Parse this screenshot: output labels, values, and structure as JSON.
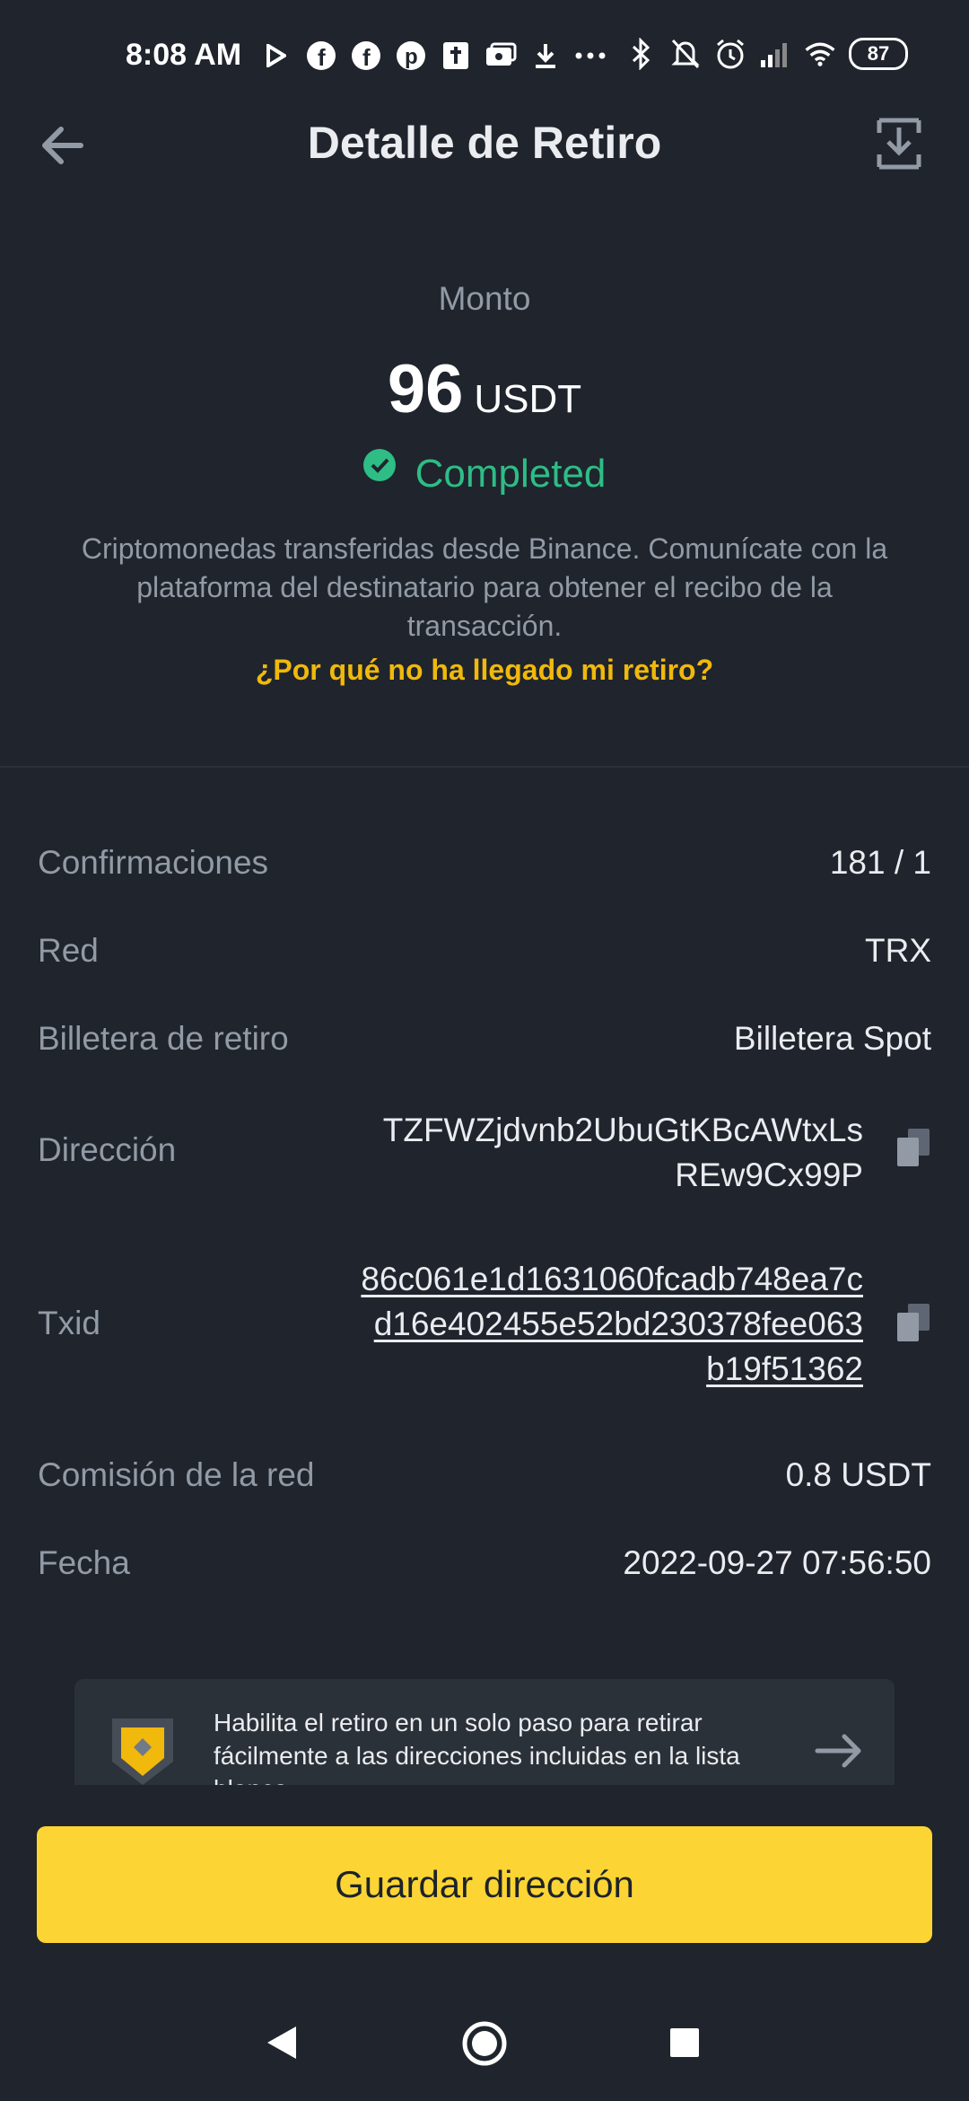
{
  "status_bar": {
    "time": "8:08 AM",
    "icons": [
      "play-icon",
      "facebook-icon",
      "facebook-icon",
      "pinterest-icon",
      "bible-icon",
      "money-icon",
      "download-icon",
      "more-icon",
      "bluetooth-icon",
      "mute-icon",
      "alarm-icon",
      "signal-icon",
      "wifi-icon"
    ],
    "battery": "87"
  },
  "header": {
    "title": "Detalle de Retiro"
  },
  "summary": {
    "amount_label": "Monto",
    "amount": "96",
    "currency": "USDT",
    "status": "Completed",
    "status_color": "#2ebd85",
    "description": "Criptomonedas transferidas desde Binance. Comunícate con la plataforma del destinatario para obtener el recibo de la transacción.",
    "help_link": "¿Por qué no ha llegado mi retiro?"
  },
  "details": {
    "confirmations_label": "Confirmaciones",
    "confirmations_value": "181 / 1",
    "network_label": "Red",
    "network_value": "TRX",
    "wallet_label": "Billetera de retiro",
    "wallet_value": "Billetera Spot",
    "address_label": "Dirección",
    "address_value": "TZFWZjdvnb2UbuGtKBcAWtxLsREw9Cx99P",
    "txid_label": "Txid",
    "txid_value": "86c061e1d1631060fcadb748ea7cd16e402455e52bd230378fee063b19f51362",
    "fee_label": "Comisión de la red",
    "fee_value": "0.8 USDT",
    "date_label": "Fecha",
    "date_value": "2022-09-27 07:56:50"
  },
  "banner": {
    "text": "Habilita el retiro en un solo paso para retirar fácilmente a las direcciones incluidas en la lista blanca."
  },
  "actions": {
    "save_address": "Guardar dirección"
  },
  "colors": {
    "background": "#1f242d",
    "accent": "#fcd535",
    "link": "#f0b90b"
  }
}
